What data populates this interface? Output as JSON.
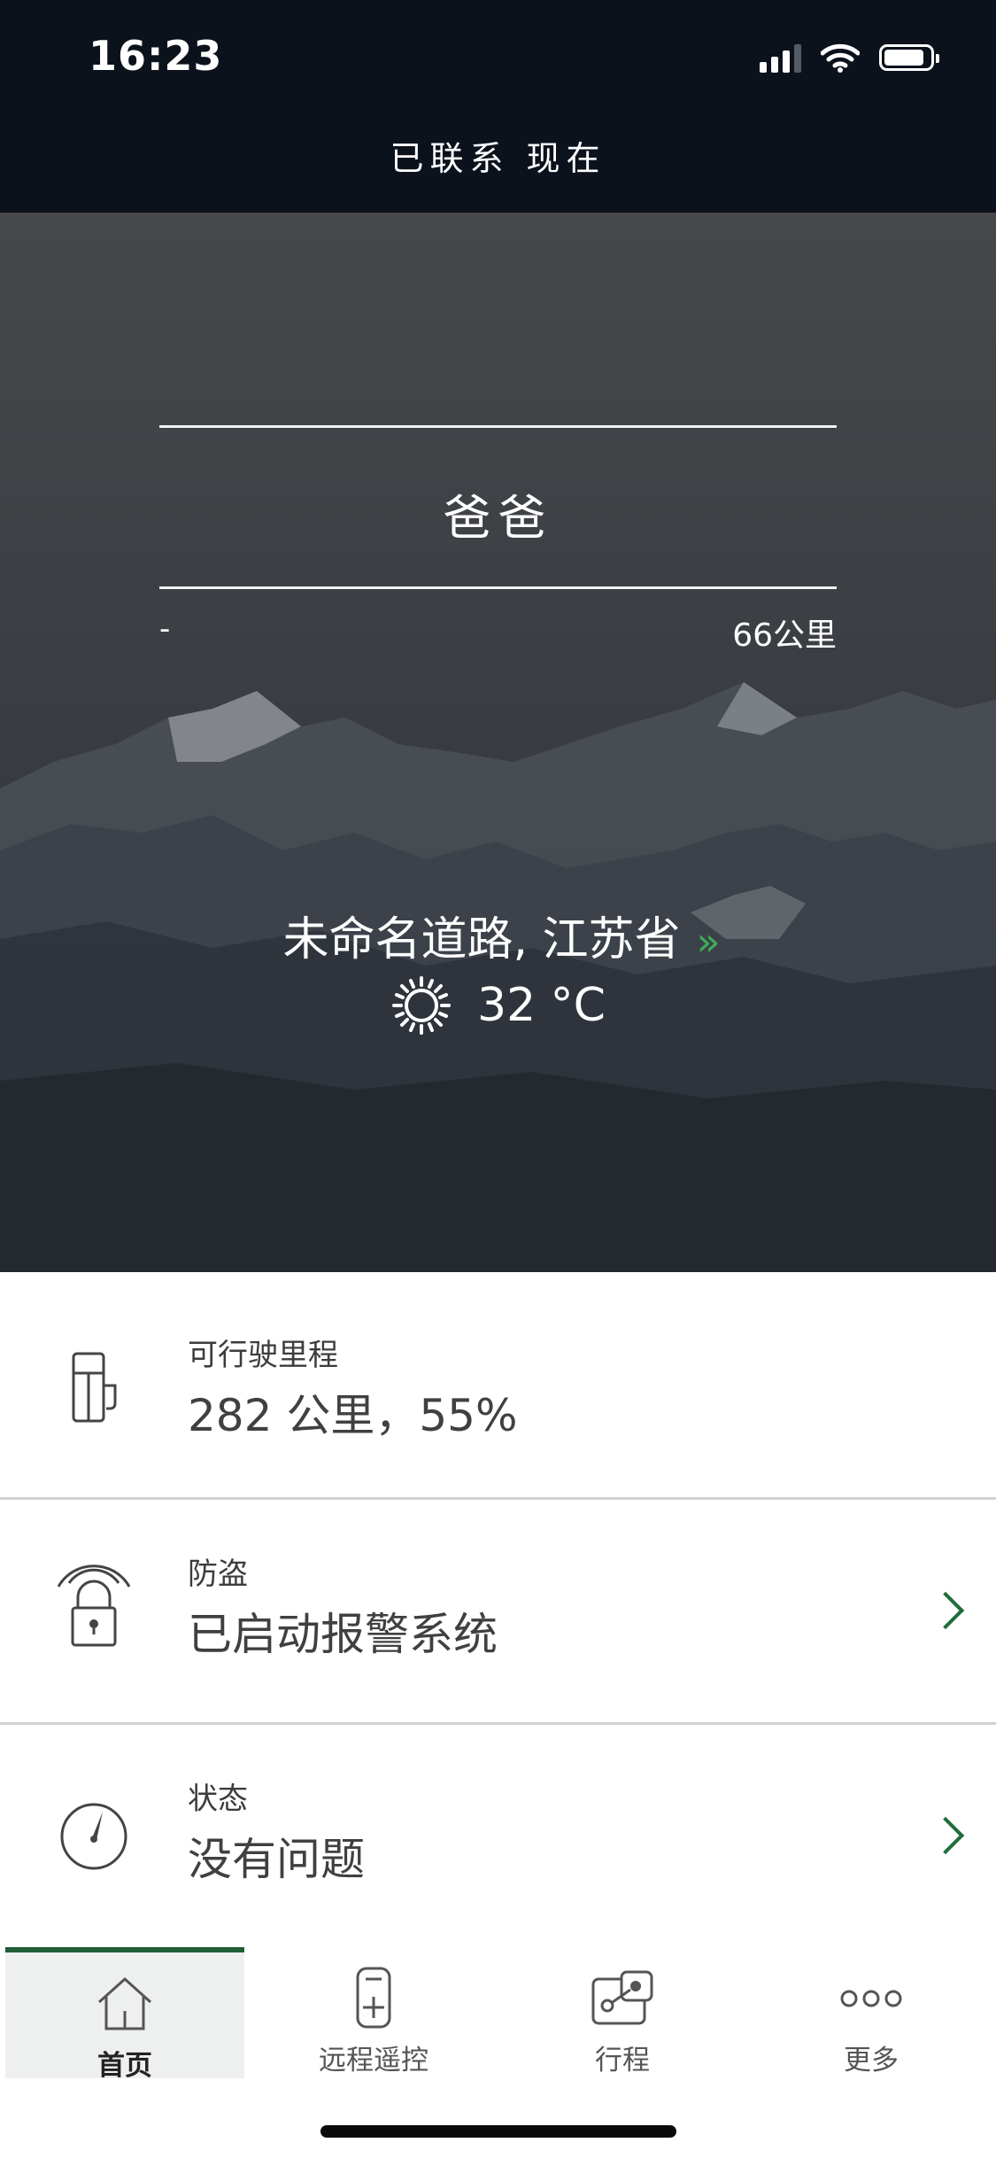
{
  "status_bar": {
    "time": "16:23"
  },
  "header": {
    "connection": "已联系 现在"
  },
  "vehicle": {
    "name": "爸爸",
    "left_value": "-",
    "odometer": "66公里"
  },
  "location": {
    "address": "未命名道路, 江苏省",
    "arrow": "»"
  },
  "weather": {
    "icon": "sun-icon",
    "temperature": "32 °C"
  },
  "rows": [
    {
      "icon": "fuel-pump-icon",
      "label": "可行驶里程",
      "value": "282 公里，55%",
      "has_chevron": false
    },
    {
      "icon": "alarm-lock-icon",
      "label": "防盗",
      "value": "已启动报警系统",
      "has_chevron": true
    },
    {
      "icon": "gauge-icon",
      "label": "状态",
      "value": "没有问题",
      "has_chevron": true
    }
  ],
  "tabs": [
    {
      "icon": "home-icon",
      "label": "首页",
      "active": true
    },
    {
      "icon": "remote-control-icon",
      "label": "远程遥控",
      "active": false
    },
    {
      "icon": "trips-icon",
      "label": "行程",
      "active": false
    },
    {
      "icon": "more-icon",
      "label": "更多",
      "active": false
    }
  ],
  "colors": {
    "accent": "#1f6e3a",
    "header_bg": "#0c121c",
    "arrow_green": "#3fae5a"
  }
}
